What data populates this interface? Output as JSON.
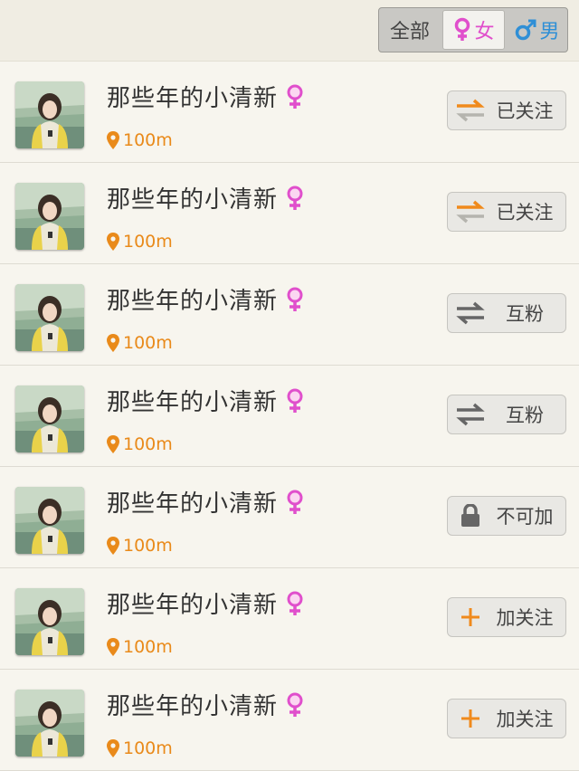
{
  "filter": {
    "all_label": "全部",
    "female_label": "女",
    "male_label": "男",
    "selected": "female"
  },
  "colors": {
    "female": "#e04fcc",
    "male": "#2f8fd6",
    "distance": "#e98a1a",
    "accent_orange": "#f08a1c"
  },
  "users": [
    {
      "name": "那些年的小清新",
      "gender_icon": "female-icon",
      "distance": "100m",
      "action": {
        "label": "已关注",
        "icon": "followed-arrows-icon"
      }
    },
    {
      "name": "那些年的小清新",
      "gender_icon": "female-icon",
      "distance": "100m",
      "action": {
        "label": "已关注",
        "icon": "followed-arrows-icon"
      }
    },
    {
      "name": "那些年的小清新",
      "gender_icon": "female-icon",
      "distance": "100m",
      "action": {
        "label": "互粉",
        "icon": "mutual-arrows-icon"
      }
    },
    {
      "name": "那些年的小清新",
      "gender_icon": "female-icon",
      "distance": "100m",
      "action": {
        "label": "互粉",
        "icon": "mutual-arrows-icon"
      }
    },
    {
      "name": "那些年的小清新",
      "gender_icon": "female-icon",
      "distance": "100m",
      "action": {
        "label": "不可加",
        "icon": "lock-icon"
      }
    },
    {
      "name": "那些年的小清新",
      "gender_icon": "female-icon",
      "distance": "100m",
      "action": {
        "label": "加关注",
        "icon": "plus-icon"
      }
    },
    {
      "name": "那些年的小清新",
      "gender_icon": "female-icon",
      "distance": "100m",
      "action": {
        "label": "加关注",
        "icon": "plus-icon"
      }
    }
  ]
}
